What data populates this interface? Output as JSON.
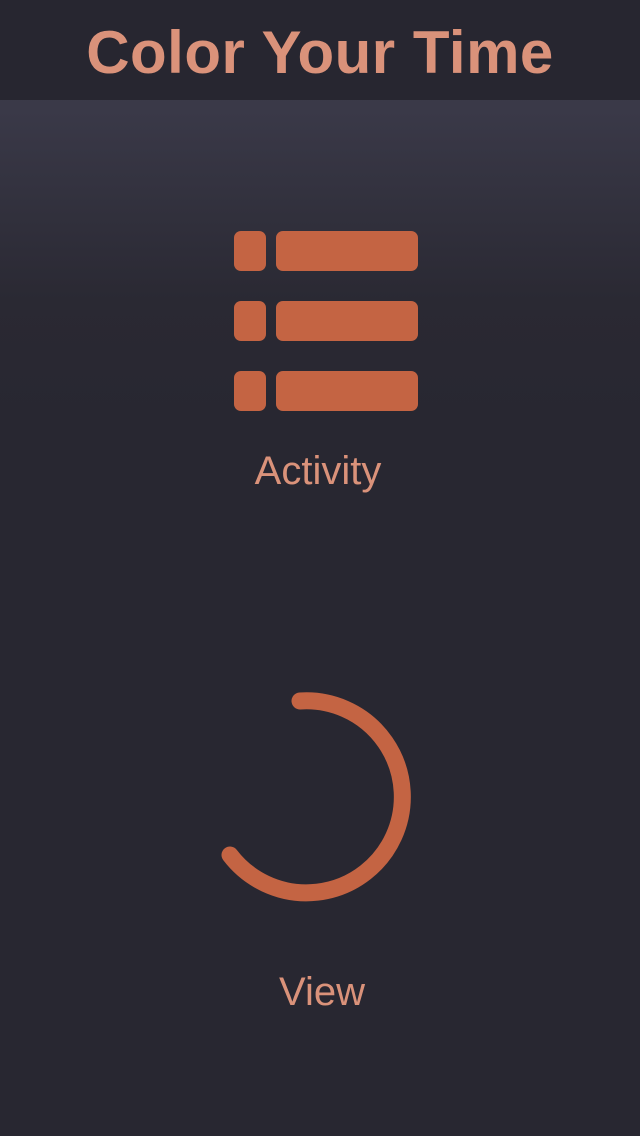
{
  "header": {
    "title": "Color Your Time"
  },
  "menu": {
    "activity": {
      "label": "Activity",
      "icon": "list-icon"
    },
    "view": {
      "label": "View",
      "icon": "progress-ring-icon"
    }
  },
  "colors": {
    "accent": "#c46443",
    "text_accent": "#da927a",
    "background": "#282731",
    "header_background": "#272630"
  }
}
